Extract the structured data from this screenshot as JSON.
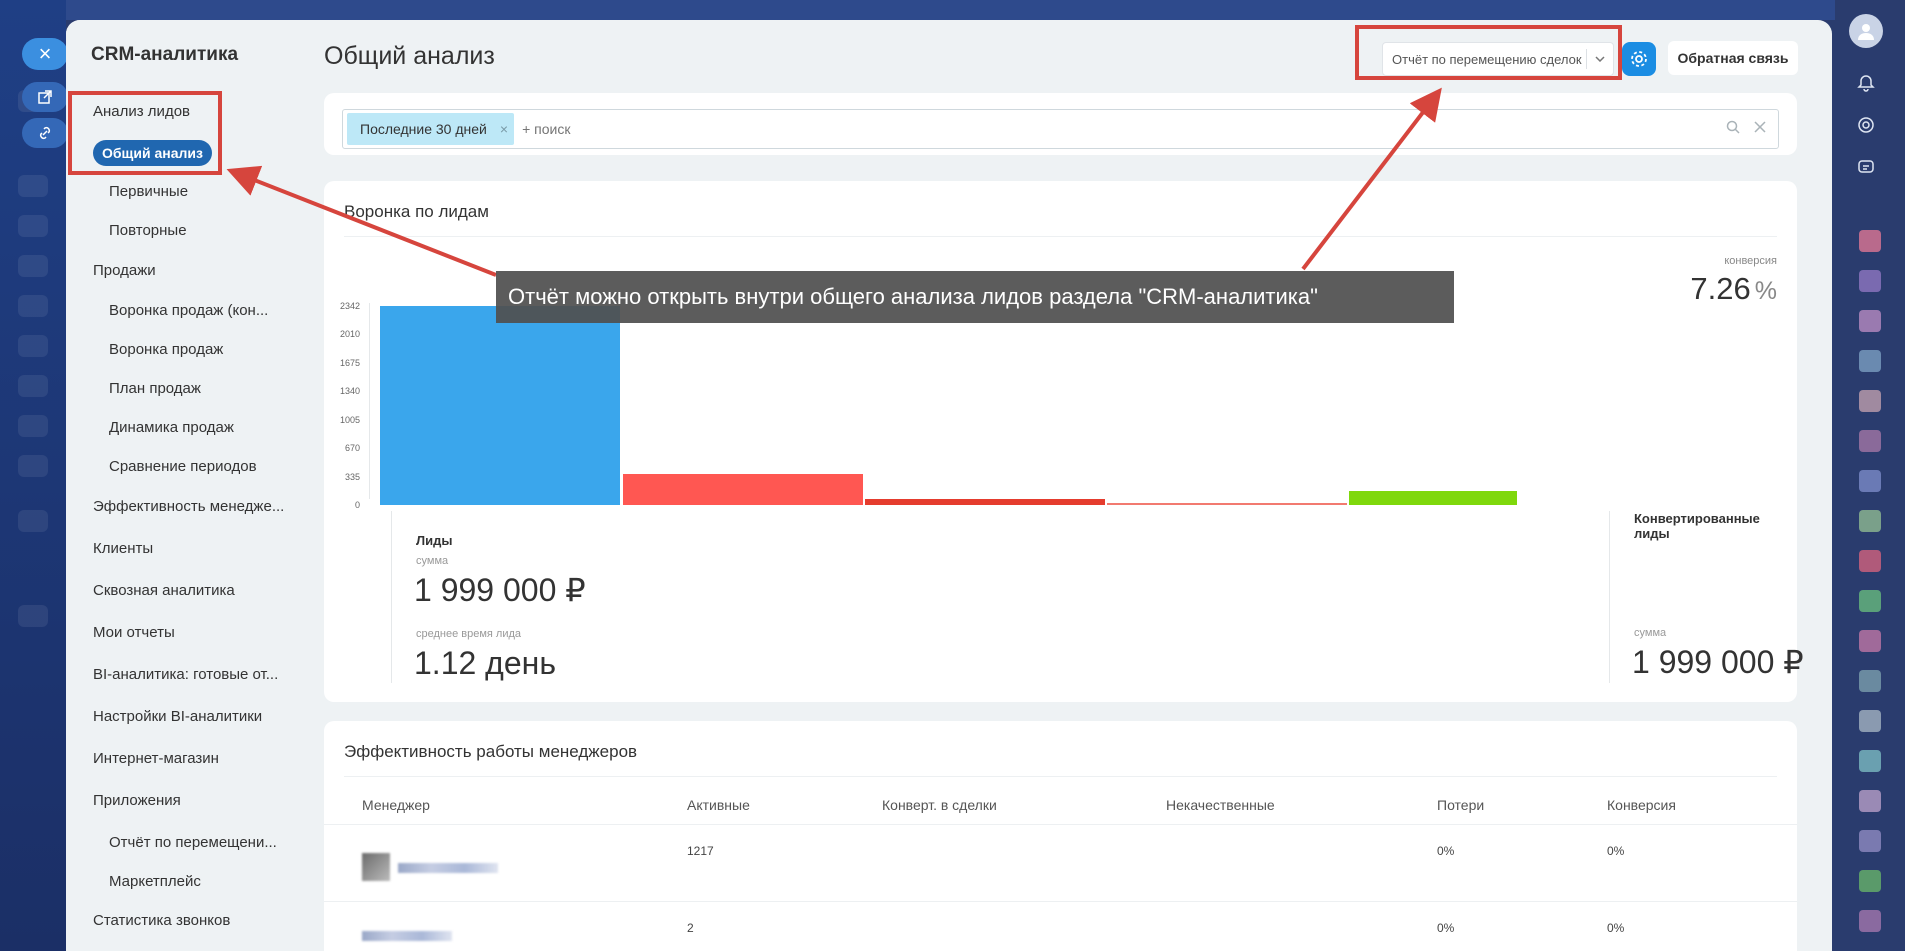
{
  "app": {
    "title": "CRM-аналитика",
    "close_icon": "×"
  },
  "sidebar": {
    "items": [
      {
        "label": "Анализ лидов",
        "level": 0
      },
      {
        "label": "Общий анализ",
        "level": 1,
        "active": true
      },
      {
        "label": "Первичные",
        "level": 1
      },
      {
        "label": "Повторные",
        "level": 1
      },
      {
        "label": "Продажи",
        "level": 0
      },
      {
        "label": "Воронка продаж (кон...",
        "level": 1
      },
      {
        "label": "Воронка продаж",
        "level": 1
      },
      {
        "label": "План продаж",
        "level": 1
      },
      {
        "label": "Динамика продаж",
        "level": 1
      },
      {
        "label": "Сравнение периодов",
        "level": 1
      },
      {
        "label": "Эффективность менедже...",
        "level": 0
      },
      {
        "label": "Клиенты",
        "level": 0
      },
      {
        "label": "Сквозная аналитика",
        "level": 0
      },
      {
        "label": "Мои отчеты",
        "level": 0
      },
      {
        "label": "BI-аналитика: готовые от...",
        "level": 0
      },
      {
        "label": "Настройки BI-аналитики",
        "level": 0
      },
      {
        "label": "Интернет-магазин",
        "level": 0
      },
      {
        "label": "Приложения",
        "level": 0
      },
      {
        "label": "Отчёт по перемещени...",
        "level": 1
      },
      {
        "label": "Маркетплейс",
        "level": 1
      },
      {
        "label": "Статистика звонков",
        "level": 0
      }
    ]
  },
  "header": {
    "title": "Общий анализ",
    "report_select": "Отчёт по перемещению сделок",
    "feedback": "Обратная связь"
  },
  "filter": {
    "chip": "Последние 30 дней",
    "chip_remove": "×",
    "search_placeholder": "+ поиск"
  },
  "funnel": {
    "title": "Воронка по лидам",
    "conversion_label": "конверсия",
    "conversion_value": "7.26",
    "conversion_unit": "%",
    "left": {
      "title": "Лиды",
      "sum_label": "сумма",
      "sum_value": "1 999 000 ₽",
      "time_label": "среднее время лида",
      "time_value": "1.12 день"
    },
    "right": {
      "title": "Конвертированные лиды",
      "sum_label": "сумма",
      "sum_value": "1 999 000 ₽"
    }
  },
  "chart_data": {
    "type": "bar",
    "title": "Воронка по лидам",
    "y_ticks": [
      "2342",
      "2010",
      "1675",
      "1340",
      "1005",
      "670",
      "335",
      "0"
    ],
    "ylim": [
      0,
      2342
    ],
    "series": [
      {
        "values": [
          2342,
          360,
          70,
          25,
          170
        ]
      }
    ],
    "colors": [
      "#3aa6ec",
      "#ff5752",
      "#e53c2e",
      "#f27a70",
      "#7fd80c"
    ]
  },
  "managers": {
    "title": "Эффективность работы менеджеров",
    "columns": [
      "Менеджер",
      "Активные",
      "Конверт. в сделки",
      "Некачественные",
      "Потери",
      "Конверсия"
    ],
    "rows": [
      {
        "active": "1217",
        "converted": "",
        "bad": "",
        "loss": "0%",
        "conversion": "0%"
      },
      {
        "active": "2",
        "converted": "",
        "bad": "",
        "loss": "0%",
        "conversion": "0%"
      }
    ]
  },
  "annotation": {
    "text": "Отчёт можно открыть внутри общего анализа лидов раздела \"CRM-аналитика\"",
    "color": "#d6453d"
  }
}
